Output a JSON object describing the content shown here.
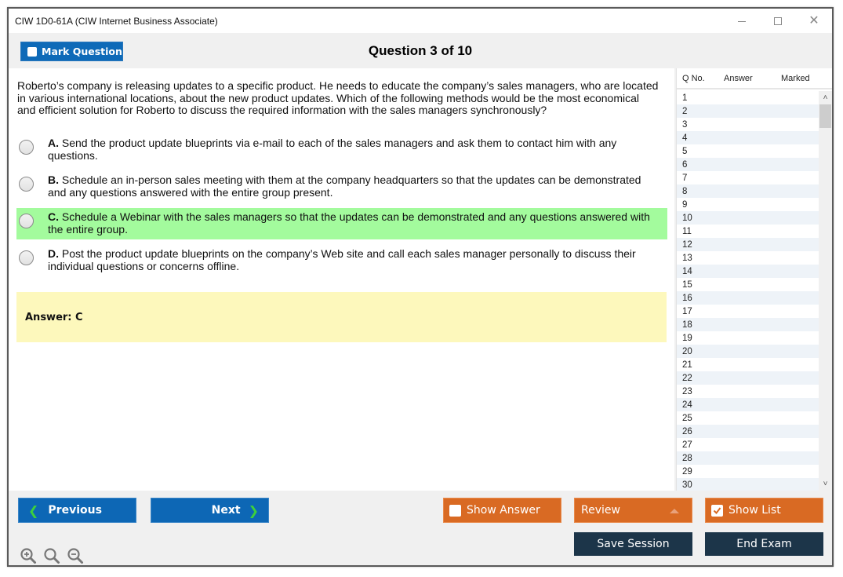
{
  "window": {
    "title": "CIW 1D0-61A (CIW Internet Business Associate)",
    "controls": [
      "minimize",
      "maximize",
      "close"
    ]
  },
  "header": {
    "mark_question_label": "Mark Question",
    "mark_question_checked": false,
    "question_title": "Question 3 of 10"
  },
  "question": {
    "text": "Roberto’s company is releasing updates to a specific product. He needs to educate the company’s sales managers, who are located in various international locations, about the new product updates. Which of the following methods would be the most economical and efficient solution for Roberto to discuss the required information with the sales managers synchronously?",
    "options": [
      {
        "letter": "A.",
        "text": "Send the product update blueprints via e-mail to each of the sales managers and ask them to contact him with any questions.",
        "correct": false,
        "selected": false
      },
      {
        "letter": "B.",
        "text": "Schedule an in-person sales meeting with them at the company headquarters so that the updates can be demonstrated and any questions answered with the entire group present.",
        "correct": false,
        "selected": false
      },
      {
        "letter": "C.",
        "text": "Schedule a Webinar with the sales managers so that the updates can be demonstrated and any questions answered with the entire group.",
        "correct": true,
        "selected": false
      },
      {
        "letter": "D.",
        "text": "Post the product update blueprints on the company’s Web site and call each sales manager personally to discuss their individual questions or concerns offline.",
        "correct": false,
        "selected": false
      }
    ],
    "answer_text": "Answer: C"
  },
  "question_list": {
    "headers": {
      "qno": "Q No.",
      "answer": "Answer",
      "marked": "Marked"
    },
    "rows": [
      "1",
      "2",
      "3",
      "4",
      "5",
      "6",
      "7",
      "8",
      "9",
      "10",
      "11",
      "12",
      "13",
      "14",
      "15",
      "16",
      "17",
      "18",
      "19",
      "20",
      "21",
      "22",
      "23",
      "24",
      "25",
      "26",
      "27",
      "28",
      "29",
      "30"
    ]
  },
  "footer": {
    "previous_label": "Previous",
    "next_label": "Next",
    "show_answer_label": "Show Answer",
    "show_answer_checked": false,
    "review_label": "Review",
    "show_list_label": "Show List",
    "show_list_checked": true,
    "save_session_label": "Save Session",
    "end_exam_label": "End Exam",
    "zoom_icons": [
      "zoom-in-icon",
      "zoom-reset-icon",
      "zoom-out-icon"
    ]
  },
  "colors": {
    "primary_blue": "#0d67b5",
    "orange": "#d96a23",
    "navy": "#1c3549",
    "correct_highlight": "#a3fb9d",
    "answer_box": "#fdf8bc",
    "chevron_green": "#3dcf3d"
  }
}
